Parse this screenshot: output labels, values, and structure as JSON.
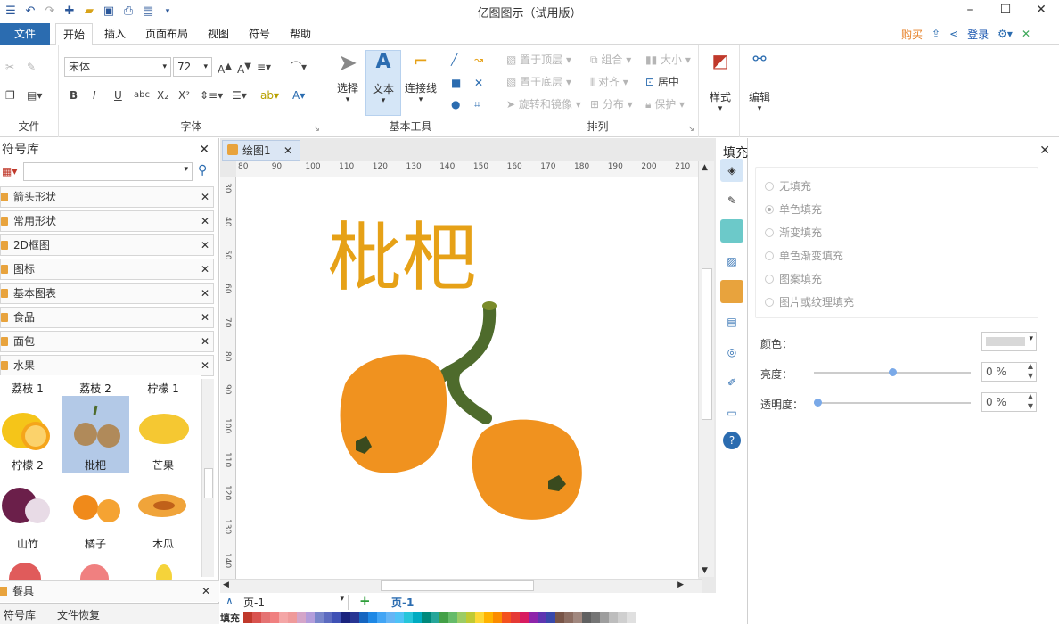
{
  "titlebar": {
    "title": "亿图图示（试用版）"
  },
  "menu": {
    "file": "文件",
    "tabs": [
      "开始",
      "插入",
      "页面布局",
      "视图",
      "符号",
      "帮助"
    ],
    "buy": "购买",
    "login": "登录"
  },
  "ribbon": {
    "groups": {
      "file": "文件",
      "font": "字体",
      "basic_tools": "基本工具",
      "arrange": "排列"
    },
    "font_name": "宋体",
    "font_size": "72",
    "select": "选择",
    "text": "文本",
    "connector": "连接线",
    "bring_front": "置于顶层",
    "send_back": "置于底层",
    "rotate_mirror": "旋转和镜像",
    "group": "组合",
    "align": "对齐",
    "distribute": "分布",
    "size": "大小",
    "center": "居中",
    "protect": "保护",
    "style": "样式",
    "edit": "编辑"
  },
  "library": {
    "title": "符号库",
    "categories": [
      "箭头形状",
      "常用形状",
      "2D框图",
      "图标",
      "基本图表",
      "食品",
      "面包",
      "水果"
    ],
    "fruit_labels_row1": [
      "荔枝 1",
      "荔枝 2",
      "柠檬 1"
    ],
    "fruit_labels_row2": [
      "柠檬 2",
      "枇杷",
      "芒果"
    ],
    "fruit_labels_row3": [
      "山竹",
      "橘子",
      "木瓜"
    ],
    "tableware": "餐具",
    "bottom_tabs": [
      "符号库",
      "文件恢复"
    ]
  },
  "canvas": {
    "tab": "绘图1",
    "heading_text": "枇杷",
    "ruler_h": [
      "80",
      "90",
      "100",
      "110",
      "120",
      "130",
      "140",
      "150",
      "160",
      "170",
      "180",
      "190",
      "200",
      "210"
    ],
    "ruler_v": [
      "30",
      "40",
      "50",
      "60",
      "70",
      "80",
      "90",
      "100",
      "110",
      "120",
      "130",
      "140"
    ]
  },
  "pages": {
    "current": "页-1",
    "tab": "页-1",
    "fill_label": "填充"
  },
  "fill_panel": {
    "title": "填充",
    "options": [
      "无填充",
      "单色填充",
      "渐变填充",
      "单色渐变填充",
      "图案填充",
      "图片或纹理填充"
    ],
    "selected": "单色填充",
    "color_label": "颜色：",
    "brightness_label": "亮度：",
    "brightness_value": "0 %",
    "transparency_label": "透明度：",
    "transparency_value": "0 %",
    "brightness_level": 0.5,
    "transparency_level": 0
  },
  "colors": {
    "accent": "#2b6cb0",
    "heading": "#e6a117",
    "fruit": "#f0921f",
    "stem": "#4e6b2c"
  }
}
